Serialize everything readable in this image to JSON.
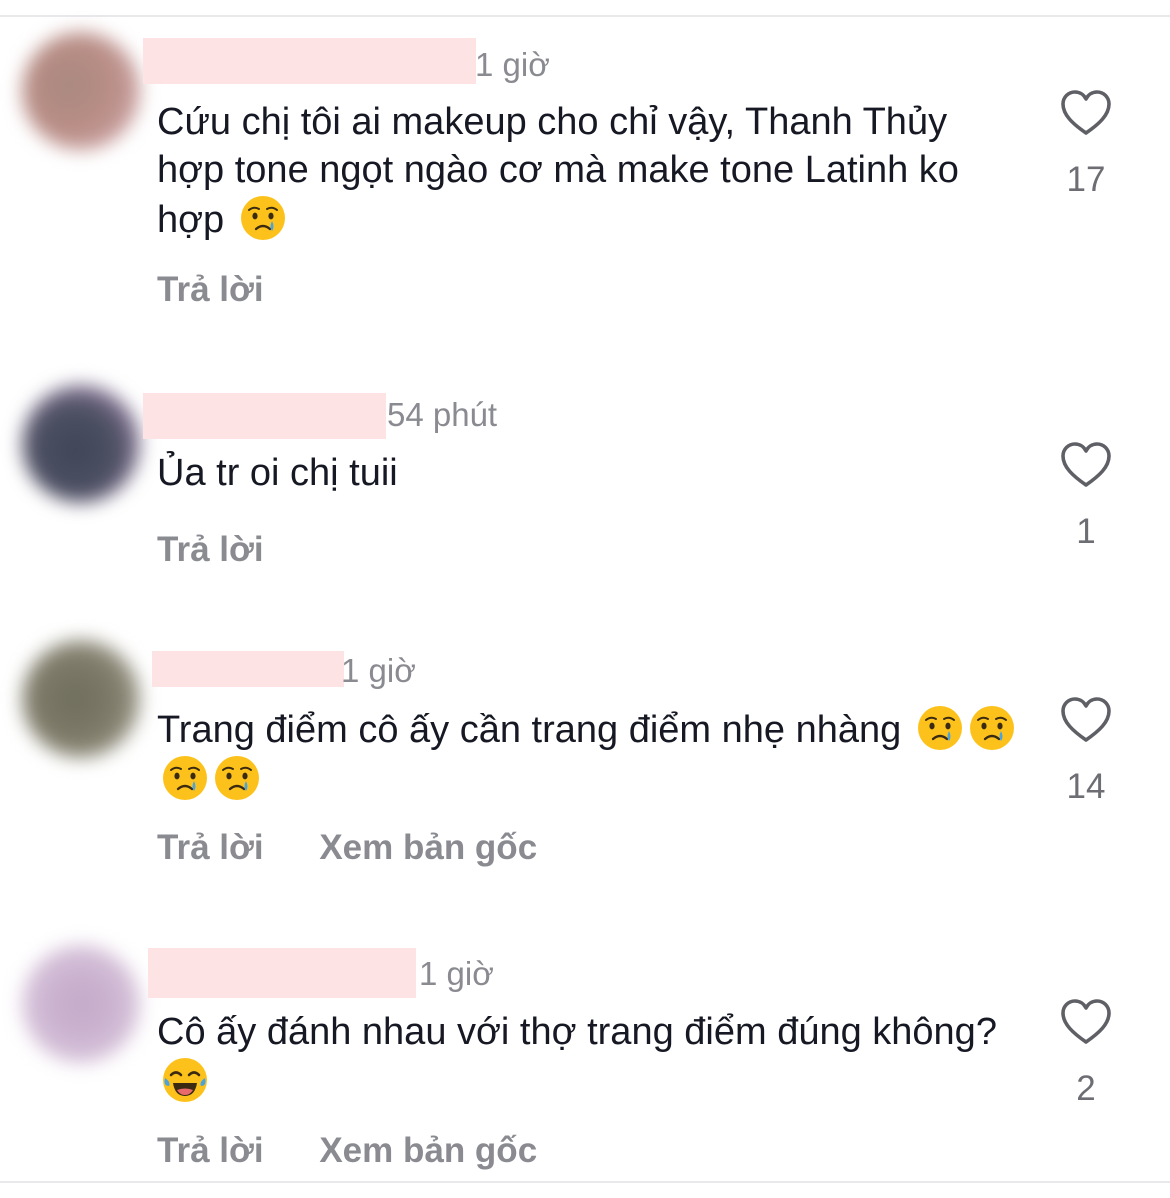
{
  "comments": [
    {
      "time": "1 giờ",
      "text": "Cứu chị tôi ai makeup cho chỉ vậy, Thanh Thủy hợp tone ngọt ngào cơ mà make tone Latinh ko hợp",
      "emojis": [
        "crying-face"
      ],
      "reply_label": "Trả lời",
      "translate_label": "",
      "likes": "17",
      "avatar_colors": [
        "#b98e86",
        "#d8b0b8"
      ]
    },
    {
      "time": "54 phút",
      "text": "Ủa tr oi chị tuii",
      "emojis": [],
      "reply_label": "Trả lời",
      "translate_label": "",
      "likes": "1",
      "avatar_colors": [
        "#4c5062",
        "#c99fd0"
      ]
    },
    {
      "time": "1 giờ",
      "text": "Trang điểm cô ấy cần trang điểm nhẹ nhàng",
      "emojis": [
        "crying-face",
        "crying-face",
        "crying-face",
        "crying-face"
      ],
      "reply_label": "Trả lời",
      "translate_label": "Xem bản gốc",
      "likes": "14",
      "avatar_colors": [
        "#7d7a68",
        "#b9b6a8"
      ]
    },
    {
      "time": "1 giờ",
      "text": "Cô ấy đánh nhau với thợ trang điểm đúng không?",
      "emojis": [
        "tears-of-joy-face"
      ],
      "reply_label": "Trả lời",
      "translate_label": "Xem bản gốc",
      "likes": "2",
      "avatar_colors": [
        "#cdb6d2",
        "#e6d6e6"
      ]
    }
  ],
  "colors": {
    "text_primary": "#161823",
    "text_secondary": "#8a8b91",
    "redaction": "#fde3e3",
    "divider": "#e9e9ec"
  },
  "icons": {
    "like": "heart-outline-icon",
    "crying": "crying-face-emoji",
    "laughing": "tears-of-joy-emoji"
  }
}
